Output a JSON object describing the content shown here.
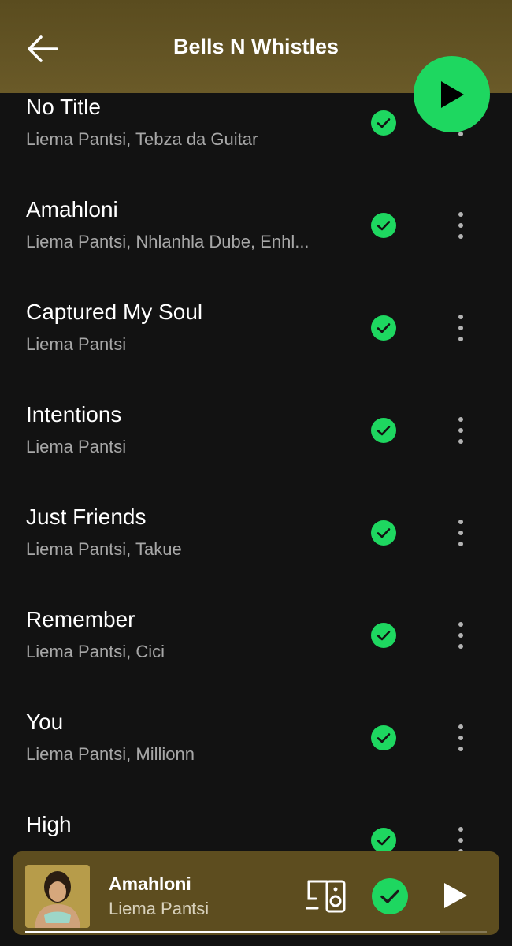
{
  "header": {
    "title": "Bells N Whistles"
  },
  "tracks": [
    {
      "title": "No Title",
      "artists": "Liema Pantsi, Tebza da Guitar",
      "downloaded": true
    },
    {
      "title": "Amahloni",
      "artists": "Liema Pantsi, Nhlanhla Dube, Enhl...",
      "downloaded": true
    },
    {
      "title": "Captured My Soul",
      "artists": "Liema Pantsi",
      "downloaded": true
    },
    {
      "title": "Intentions",
      "artists": "Liema Pantsi",
      "downloaded": true
    },
    {
      "title": "Just Friends",
      "artists": "Liema Pantsi, Takue",
      "downloaded": true
    },
    {
      "title": "Remember",
      "artists": "Liema Pantsi, Cici",
      "downloaded": true
    },
    {
      "title": "You",
      "artists": "Liema Pantsi, Millionn",
      "downloaded": true
    },
    {
      "title": "High",
      "artists": "",
      "downloaded": true
    }
  ],
  "now_playing": {
    "title": "Amahloni",
    "artist": "Liema Pantsi",
    "progress_fraction": 0.9
  },
  "colors": {
    "accent": "#1ed760",
    "background": "#121212",
    "header": "#5a4c1f",
    "mini_player": "#5d4d1f",
    "secondary_text": "#a7a7a7"
  },
  "icons": {
    "back": "arrow-left",
    "play": "play-triangle",
    "downloaded": "check-circle",
    "more": "vertical-ellipsis",
    "devices": "connect-device"
  }
}
